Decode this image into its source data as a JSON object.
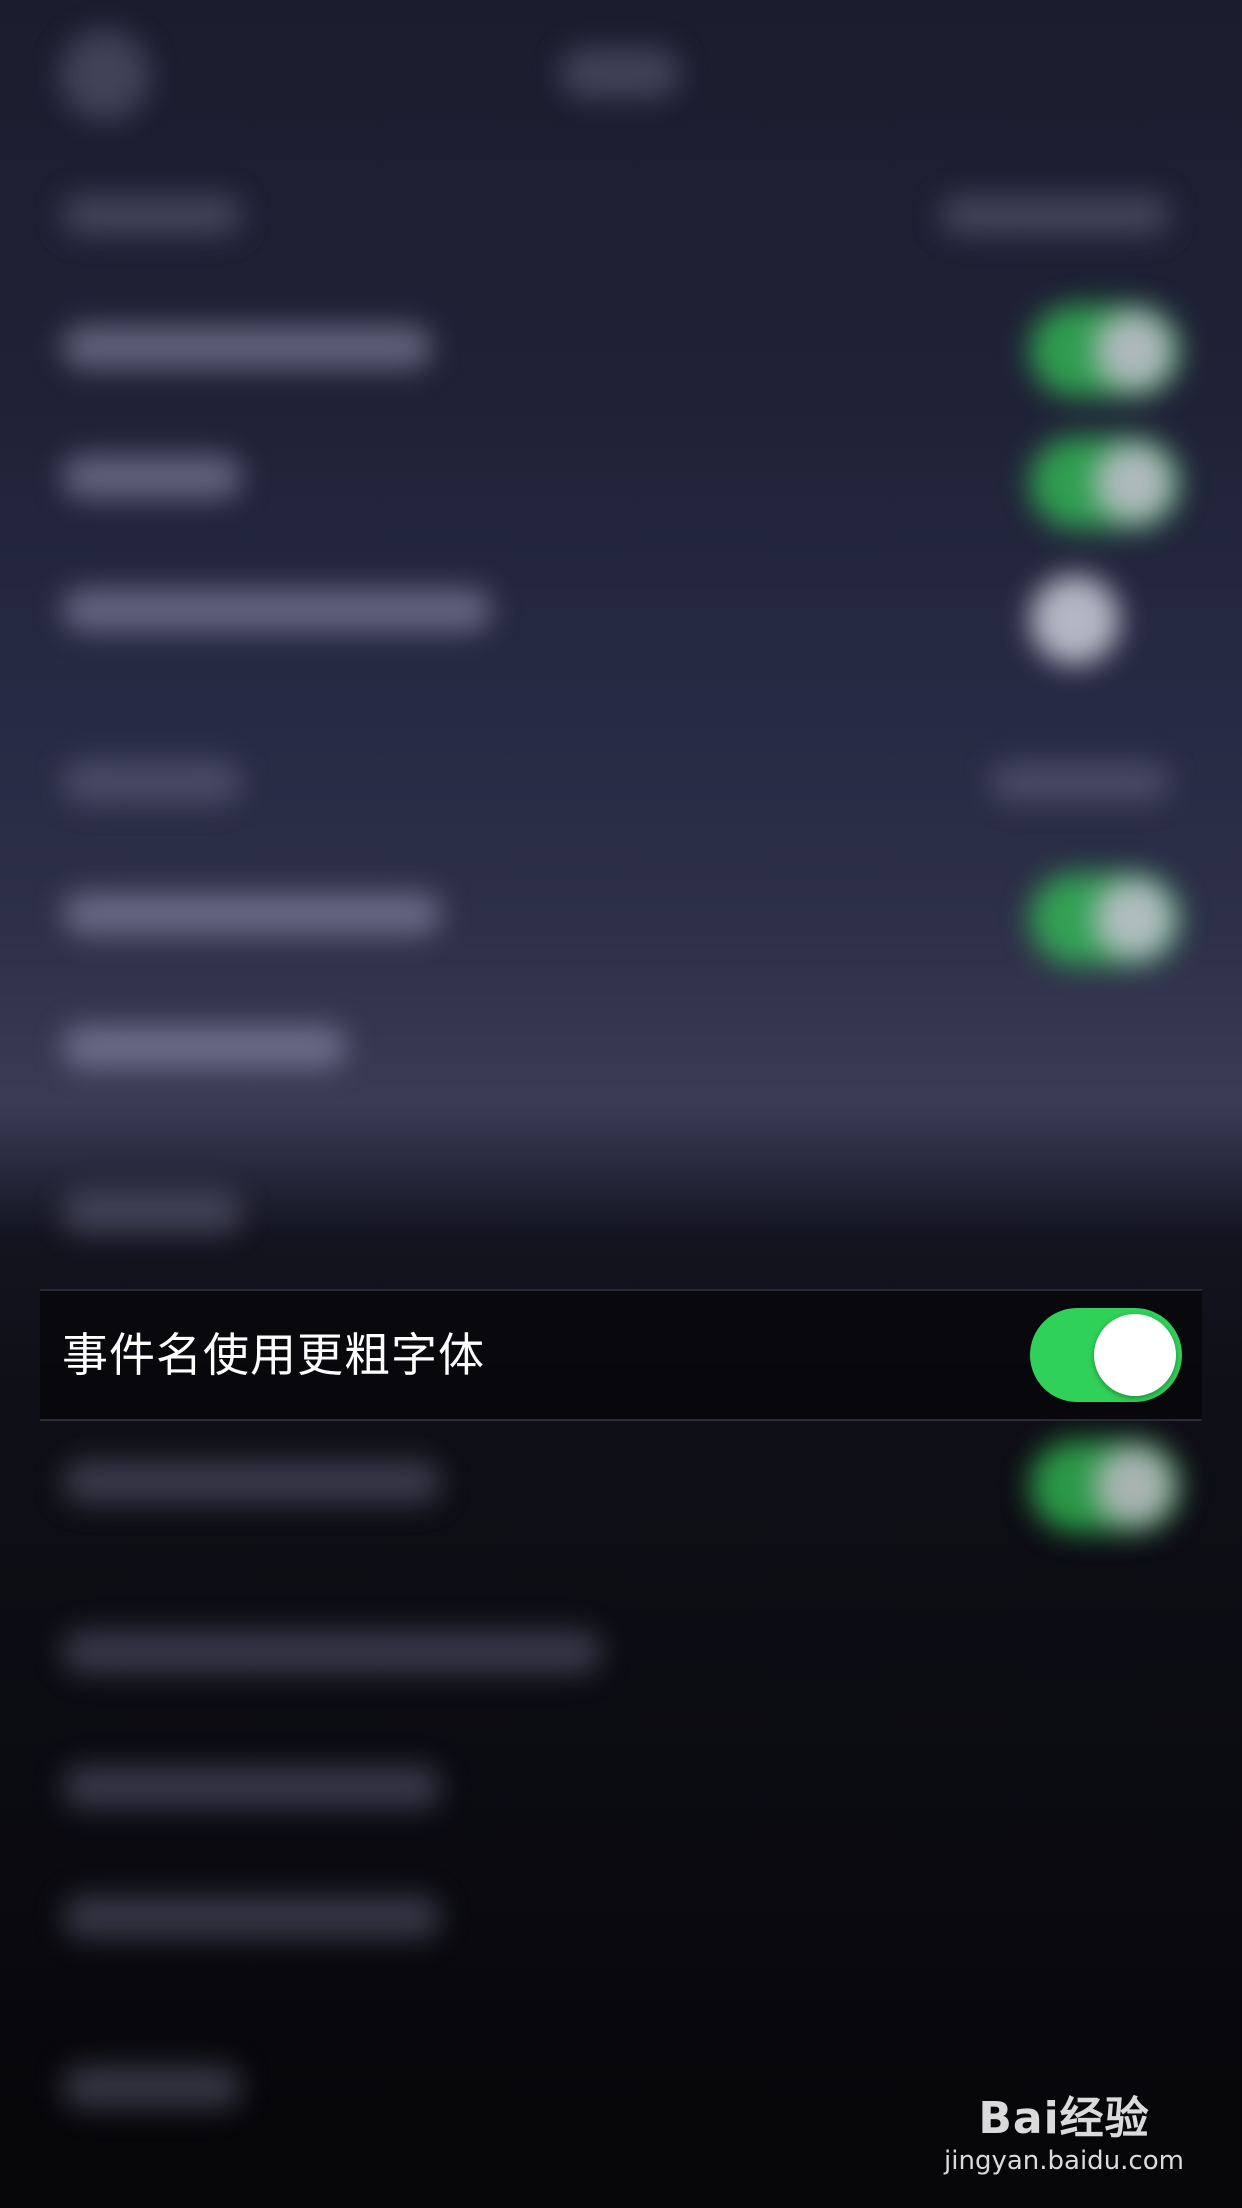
{
  "settings": {
    "focused_row": {
      "label": "事件名使用更粗字体",
      "toggle_on": true
    }
  },
  "colors": {
    "toggle_on": "#30d158",
    "knob": "#ffffff",
    "row_background": "#08080c"
  },
  "watermark": {
    "brand": "Bai经验",
    "url": "jingyan.baidu.com"
  }
}
